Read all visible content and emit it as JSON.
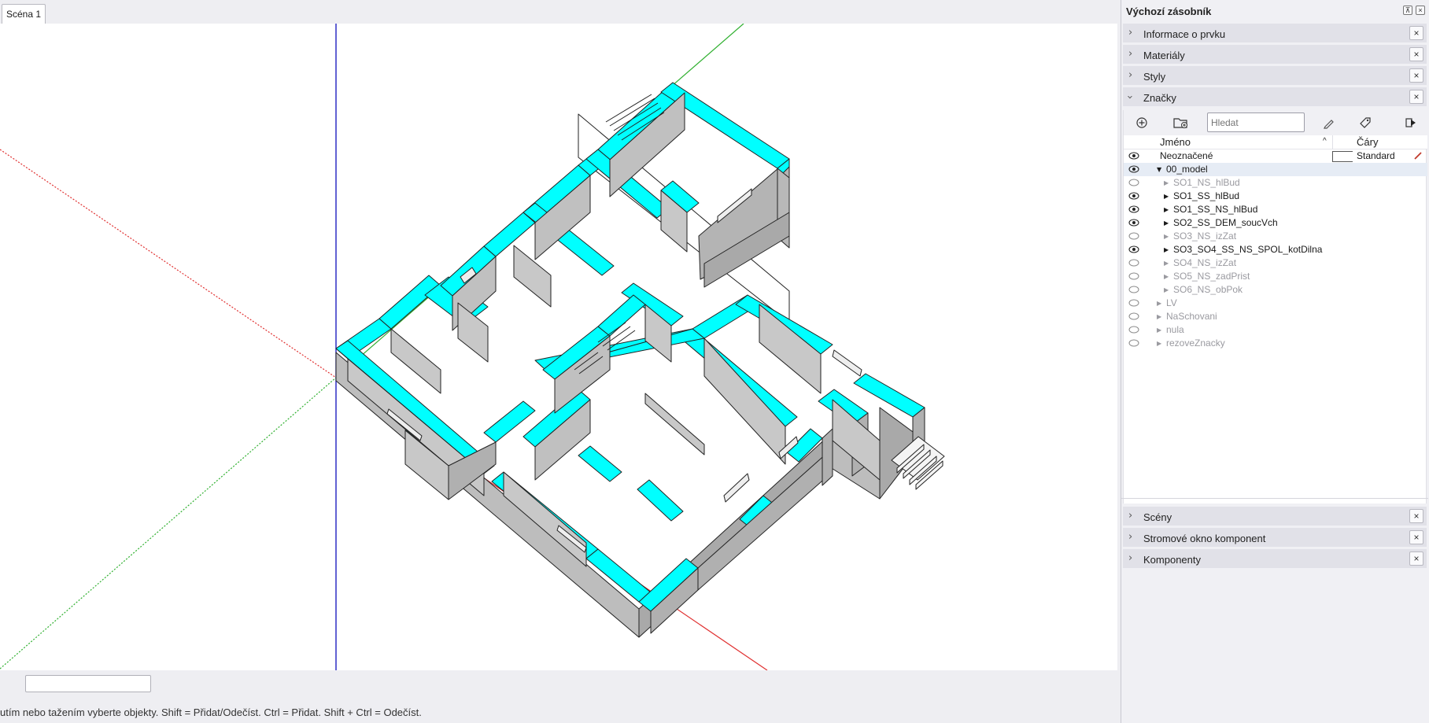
{
  "scene_tab": {
    "label": "Scéna 1"
  },
  "status": {
    "hint": "utím nebo tažením vyberte objekty. Shift = Přidat/Odečíst. Ctrl = Přidat. Shift + Ctrl = Odečíst.",
    "measurements_value": ""
  },
  "tray": {
    "title": "Výchozí zásobník",
    "pin_icon": "pin-icon",
    "close_icon": "close-icon",
    "panels_top": [
      {
        "label": "Informace o prvku",
        "expanded": false
      },
      {
        "label": "Materiály",
        "expanded": false
      },
      {
        "label": "Styly",
        "expanded": false
      },
      {
        "label": "Značky",
        "expanded": true
      }
    ],
    "panels_bottom": [
      {
        "label": "Scény",
        "expanded": false
      },
      {
        "label": "Stromové okno komponent",
        "expanded": false
      },
      {
        "label": "Komponenty",
        "expanded": false
      }
    ]
  },
  "tags": {
    "search_placeholder": "Hledat",
    "toolbar_icons": [
      "add-tag-icon",
      "add-folder-icon",
      "search-icon",
      "tag-color-icon",
      "tag-tool-icon",
      "details-arrow-icon"
    ],
    "columns": {
      "name": "Jméno",
      "lines": "Čáry"
    },
    "rows": [
      {
        "name": "Neoznačené",
        "visible": true,
        "indent": 0,
        "arrow": "",
        "dim": false,
        "selected": false,
        "linestyle": "Standard",
        "has_swatch": true
      },
      {
        "name": "00_model",
        "visible": true,
        "indent": 0,
        "arrow": "▼",
        "dim": false,
        "selected": true
      },
      {
        "name": "SO1_NS_hlBud",
        "visible": false,
        "indent": 1,
        "arrow": "▶",
        "dim": true,
        "selected": false
      },
      {
        "name": "SO1_SS_hlBud",
        "visible": true,
        "indent": 1,
        "arrow": "▶",
        "dim": false,
        "selected": false
      },
      {
        "name": "SO1_SS_NS_hlBud",
        "visible": true,
        "indent": 1,
        "arrow": "▶",
        "dim": false,
        "selected": false
      },
      {
        "name": "SO2_SS_DEM_soucVch",
        "visible": true,
        "indent": 1,
        "arrow": "▶",
        "dim": false,
        "selected": false
      },
      {
        "name": "SO3_NS_izZat",
        "visible": false,
        "indent": 1,
        "arrow": "▶",
        "dim": true,
        "selected": false
      },
      {
        "name": "SO3_SO4_SS_NS_SPOL_kotDilna",
        "visible": true,
        "indent": 1,
        "arrow": "▶",
        "dim": false,
        "selected": false
      },
      {
        "name": "SO4_NS_izZat",
        "visible": false,
        "indent": 1,
        "arrow": "▶",
        "dim": true,
        "selected": false
      },
      {
        "name": "SO5_NS_zadPrist",
        "visible": false,
        "indent": 1,
        "arrow": "▶",
        "dim": true,
        "selected": false
      },
      {
        "name": "SO6_NS_obPok",
        "visible": false,
        "indent": 1,
        "arrow": "▶",
        "dim": true,
        "selected": false
      },
      {
        "name": "LV",
        "visible": false,
        "indent": 0,
        "arrow": "▶",
        "dim": true,
        "selected": false
      },
      {
        "name": "NaSchovani",
        "visible": false,
        "indent": 0,
        "arrow": "▶",
        "dim": true,
        "selected": false
      },
      {
        "name": "nula",
        "visible": false,
        "indent": 0,
        "arrow": "▶",
        "dim": true,
        "selected": false
      },
      {
        "name": "rezoveZnacky",
        "visible": false,
        "indent": 0,
        "arrow": "▶",
        "dim": true,
        "selected": false
      }
    ]
  },
  "colors": {
    "wall_cut": "#00ffff",
    "wall_face": "#c8c8c8",
    "wall_face_dark": "#a8a8a8",
    "axis_red": "#e03030",
    "axis_green": "#30b030",
    "axis_blue": "#2020c0",
    "accent_selected": "#e6ecf5"
  }
}
